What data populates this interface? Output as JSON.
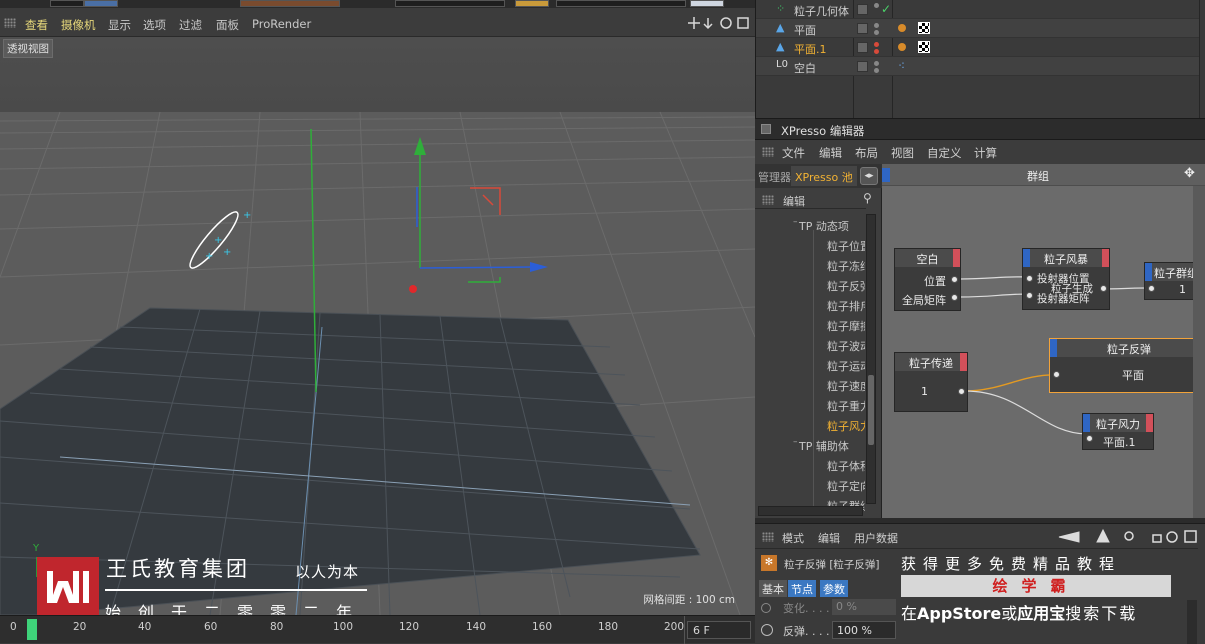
{
  "viewport": {
    "menu": [
      "查看",
      "摄像机",
      "显示",
      "选项",
      "过滤",
      "面板",
      "ProRender"
    ],
    "view_label": "透视视图",
    "grid_note": "网格间距 : 100 cm",
    "axis_y_label": "Y"
  },
  "timeline": {
    "ticks": [
      "0",
      "20",
      "40",
      "60",
      "80",
      "100",
      "120",
      "140",
      "160",
      "180",
      "200"
    ],
    "frame_field": "6 F"
  },
  "watermark": {
    "logo_letter": "W",
    "title": "王氏教育集团",
    "slogan": "以人为本",
    "subtitle": "始创于二零零二年"
  },
  "object_manager": {
    "rows": [
      {
        "name": "粒子几何体",
        "selected": false
      },
      {
        "name": "平面",
        "selected": false
      },
      {
        "name": "平面.1",
        "selected": true
      },
      {
        "name": "空白",
        "selected": false
      }
    ]
  },
  "xpresso": {
    "title": "XPresso 编辑器",
    "menu": [
      "文件",
      "编辑",
      "布局",
      "视图",
      "自定义",
      "计算"
    ],
    "pool_tabs": [
      "管理器",
      "XPresso 池"
    ],
    "pool_edit": "编辑",
    "pool_categories": [
      "TP 动态项",
      "TP 辅助体"
    ],
    "pool_items_a": [
      "粒子位置",
      "粒子冻结",
      "粒子反弹",
      "粒子排斥",
      "粒子摩擦",
      "粒子波动",
      "粒子运动",
      "粒子速度",
      "粒子重力",
      "粒子风力"
    ],
    "pool_items_b": [
      "粒子体积",
      "粒子定向",
      "粒子群组"
    ],
    "group_title": "群组",
    "nodes": {
      "empty": {
        "title": "空白",
        "ports": [
          "位置",
          "全局矩阵"
        ]
      },
      "storm": {
        "title": "粒子风暴",
        "ports": [
          "投射器位置",
          "粒子生成",
          "投射器矩阵"
        ]
      },
      "group": {
        "title": "粒子群组",
        "value": "1"
      },
      "pass": {
        "title": "粒子传递",
        "value": "1"
      },
      "bounce": {
        "title": "粒子反弹",
        "value": "平面"
      },
      "wind": {
        "title": "粒子风力",
        "value": "平面.1"
      }
    }
  },
  "attributes": {
    "menu": [
      "模式",
      "编辑",
      "用户数据"
    ],
    "object_label": "粒子反弹 [粒子反弹]",
    "tabs": [
      "基本",
      "节点",
      "参数"
    ],
    "row1_label": "变化. . . . .",
    "row1_value": "0 %",
    "row2_label": "反弹. . . . .",
    "row2_value": "100 %"
  },
  "ad": {
    "line1": "获得更多免费精品教程",
    "bar": "绘学霸",
    "line2_a": "在",
    "line2_b": "AppStore",
    "line2_c": "或",
    "line2_d": "应用宝",
    "line2_e": "搜索下载"
  },
  "colors": {
    "accent": "#f2b233",
    "brand_red": "#c0262d",
    "node_in": "#2f66c4",
    "node_out": "#d2505a"
  }
}
